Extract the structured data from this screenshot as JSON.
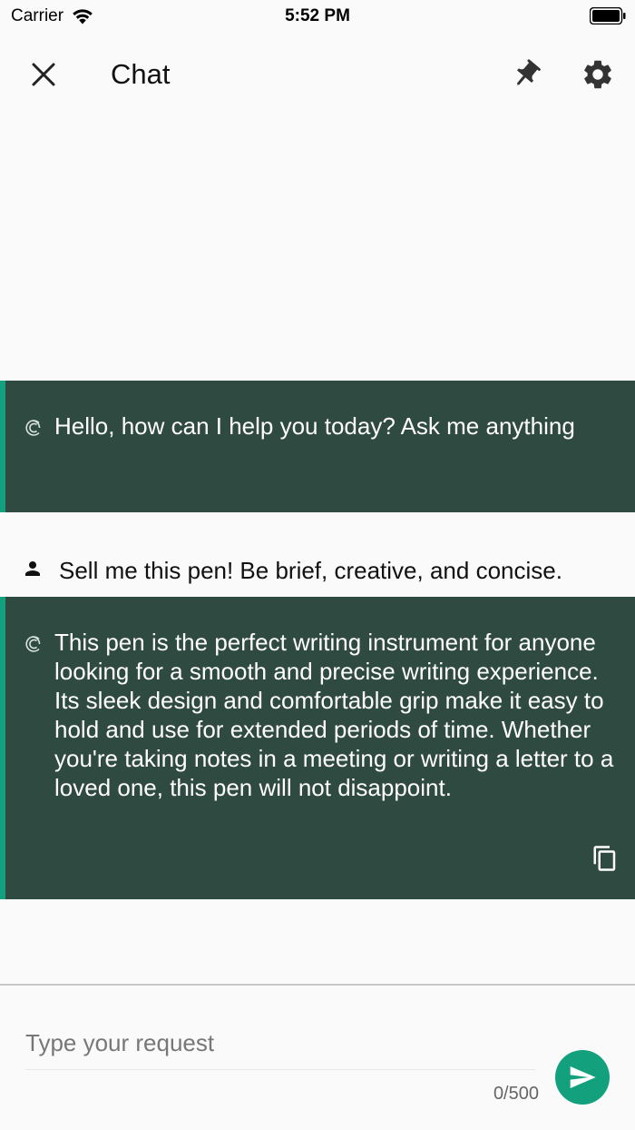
{
  "status_bar": {
    "carrier": "Carrier",
    "time": "5:52 PM"
  },
  "app_bar": {
    "title": "Chat"
  },
  "messages": [
    {
      "role": "bot",
      "text": "Hello, how can I help you today? Ask me anything"
    },
    {
      "role": "user",
      "text": "Sell me this pen! Be brief, creative, and concise."
    },
    {
      "role": "bot",
      "text": "This pen is the perfect writing instrument for anyone looking for a smooth and precise writing experience. Its sleek design and comfortable grip make it easy to hold and use for extended periods of time. Whether you're taking notes in a meeting or writing a letter to a loved one, this pen will not disappoint."
    }
  ],
  "input": {
    "placeholder": "Type your request",
    "value": "",
    "counter": "0/500"
  },
  "colors": {
    "accent": "#12a17c",
    "bot_bubble": "#2f4a41",
    "background": "#fafafa"
  },
  "icons": {
    "close": "close-icon",
    "pin": "pin-icon",
    "settings": "gear-icon",
    "bot": "chatgpt-logo-icon",
    "user": "person-icon",
    "copy": "copy-icon",
    "send": "send-icon"
  }
}
